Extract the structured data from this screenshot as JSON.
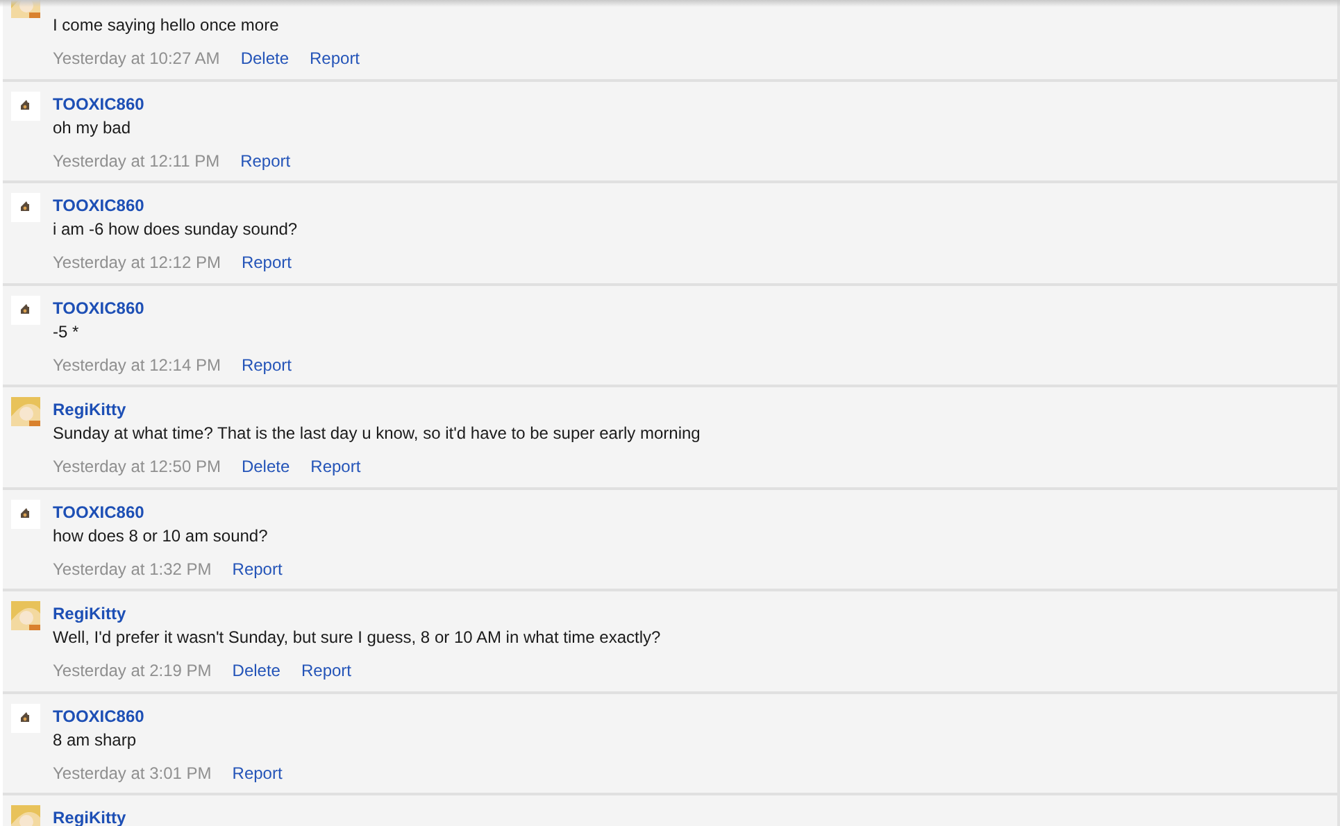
{
  "messages": [
    {
      "kind": "illustrated",
      "text": "I come saying hello once more",
      "time": "Yesterday at 10:27 AM",
      "actions": [
        "Delete",
        "Report"
      ]
    },
    {
      "author": "TOOXIC860",
      "kind": "emblem",
      "text": "oh my bad",
      "time": "Yesterday at 12:11 PM",
      "actions": [
        "Report"
      ]
    },
    {
      "author": "TOOXIC860",
      "kind": "emblem",
      "text": "i am -6 how does sunday sound?",
      "time": "Yesterday at 12:12 PM",
      "actions": [
        "Report"
      ]
    },
    {
      "author": "TOOXIC860",
      "kind": "emblem",
      "text": "-5 *",
      "time": "Yesterday at 12:14 PM",
      "actions": [
        "Report"
      ]
    },
    {
      "author": "RegiKitty",
      "kind": "illustrated",
      "text": "Sunday at what time? That is the last day u know, so it'd have to be super early morning",
      "time": "Yesterday at 12:50 PM",
      "actions": [
        "Delete",
        "Report"
      ]
    },
    {
      "author": "TOOXIC860",
      "kind": "emblem",
      "text": "how does 8 or 10 am sound?",
      "time": "Yesterday at 1:32 PM",
      "actions": [
        "Report"
      ]
    },
    {
      "author": "RegiKitty",
      "kind": "illustrated",
      "text": "Well, I'd prefer it wasn't Sunday, but sure I guess, 8 or 10 AM in what time exactly?",
      "time": "Yesterday at 2:19 PM",
      "actions": [
        "Delete",
        "Report"
      ]
    },
    {
      "author": "TOOXIC860",
      "kind": "emblem",
      "text": "8 am sharp",
      "time": "Yesterday at 3:01 PM",
      "actions": [
        "Report"
      ]
    },
    {
      "author": "RegiKitty",
      "kind": "illustrated"
    }
  ]
}
